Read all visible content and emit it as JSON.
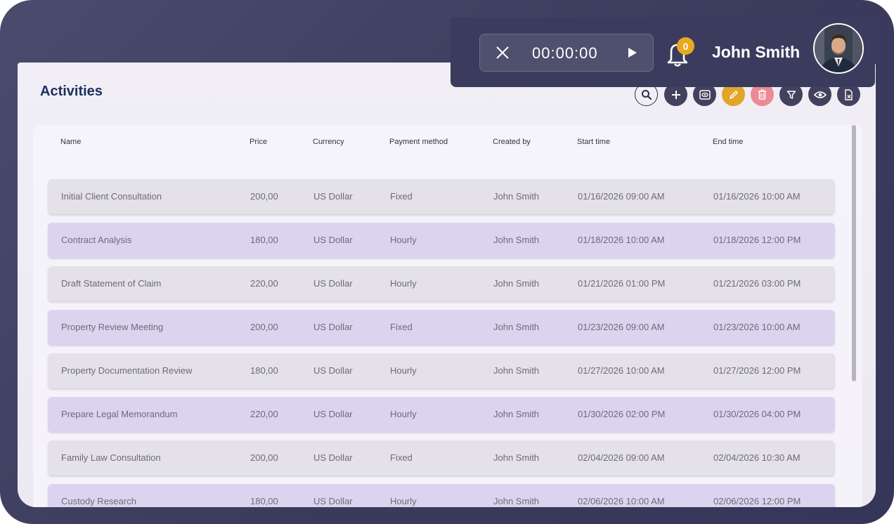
{
  "page": {
    "title": "Activities"
  },
  "toolbar": {
    "buttons": [
      "search-icon",
      "plus-icon",
      "preview-icon",
      "edit-icon",
      "trash-icon",
      "filter-icon",
      "eye-icon",
      "clear-file-icon"
    ]
  },
  "timer": {
    "time": "00:00:00"
  },
  "notifications": {
    "count": "0"
  },
  "user": {
    "name": "John Smith"
  },
  "table": {
    "columns": [
      "Name",
      "Price",
      "Currency",
      "Payment method",
      "Created by",
      "Start time",
      "End time"
    ],
    "rows": [
      [
        "Initial Client Consultation",
        "200,00",
        "US Dollar",
        "Fixed",
        "John Smith",
        "01/16/2026 09:00 AM",
        "01/16/2026 10:00 AM"
      ],
      [
        "Contract Analysis",
        "180,00",
        "US Dollar",
        "Hourly",
        "John Smith",
        "01/18/2026 10:00 AM",
        "01/18/2026 12:00 PM"
      ],
      [
        "Draft Statement of Claim",
        "220,00",
        "US Dollar",
        "Hourly",
        "John Smith",
        "01/21/2026 01:00 PM",
        "01/21/2026 03:00 PM"
      ],
      [
        "Property Review Meeting",
        "200,00",
        "US Dollar",
        "Fixed",
        "John Smith",
        "01/23/2026 09:00 AM",
        "01/23/2026 10:00 AM"
      ],
      [
        "Property Documentation Review",
        "180,00",
        "US Dollar",
        "Hourly",
        "John Smith",
        "01/27/2026 10:00 AM",
        "01/27/2026 12:00 PM"
      ],
      [
        "Prepare Legal Memorandum",
        "220,00",
        "US Dollar",
        "Hourly",
        "John Smith",
        "01/30/2026 02:00 PM",
        "01/30/2026 04:00 PM"
      ],
      [
        "Family Law Consultation",
        "200,00",
        "US Dollar",
        "Fixed",
        "John Smith",
        "02/04/2026 09:00 AM",
        "02/04/2026 10:30 AM"
      ],
      [
        "Custody Research",
        "180,00",
        "US Dollar",
        "Hourly",
        "John Smith",
        "02/06/2026 10:00 AM",
        "02/06/2026 12:00 PM"
      ]
    ]
  },
  "colors": {
    "accent": "#1c2f5e",
    "edit": "#e2a52a",
    "delete": "#eb8a94",
    "badge": "#e9a820"
  }
}
